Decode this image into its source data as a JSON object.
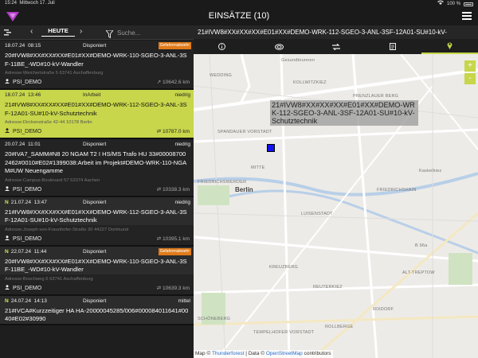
{
  "status": {
    "time": "15:24",
    "date": "Mittwoch 17. Juli",
    "battery": "100 %"
  },
  "header": {
    "title": "EINSÄTZE (10)"
  },
  "list_toolbar": {
    "today_label": "HEUTE",
    "search_placeholder": "Suche..."
  },
  "detail": {
    "title": "21#IVW8#XX#XX#XX#E01#XX#DEMO-WRK-112-SGEO-3-ANL-3SF-12A01-SU#10-kV-"
  },
  "cards": [
    {
      "date": "18.07.24",
      "time": "08:15",
      "status": "Disponiert",
      "badge": "Gefahrenabwehr",
      "priority": "",
      "n": "",
      "text": "20#IVW8#XX#XX#XX#E01#XX#DEMO-WRK-110-SGEO-3-ANL-3SF-11BE_-WD#10-kV-Wandler",
      "address": "Adresse:Weichertstraße 5 63741 Aschaffenburg",
      "user": "PSI_DEMO",
      "distance": "10642.6 km"
    },
    {
      "date": "18.07.24",
      "time": "13:46",
      "status": "InArbeit",
      "badge": "",
      "priority": "niedrig",
      "n": "",
      "text": "21#IVW8#XX#XX#XX#E01#XX#DEMO-WRK-112-SGEO-3-ANL-3SF-12A01-SU#10-kV-Schutztechnik",
      "address": "Adresse:Dirckenstraße 42-44 10178 Berlin",
      "user": "PSI_DEMO",
      "distance": "10787.0 km"
    },
    {
      "date": "20.07.24",
      "time": "11:01",
      "status": "Disponiert",
      "badge": "",
      "priority": "niedrig",
      "n": "",
      "text": "20#IVA7_SAMM#N8 20 NGAM T2 I HS/MS Trafo HU 33#000087002462#0010#E02#1399038:Arbeit im Projekt#DEMO-WRK-110-NGAM#UW Neuengamme",
      "address": "Adresse:Campus-Boulevard 57 52074 Aachen",
      "user": "PSI_DEMO",
      "distance": "10338.3 km"
    },
    {
      "date": "21.07.24",
      "time": "13:47",
      "status": "Disponiert",
      "badge": "",
      "priority": "niedrig",
      "n": "N",
      "text": "21#IVW8#XX#XX#XX#E01#XX#DEMO-WRK-112-SGEO-3-ANL-3SF-12A01-SU#10-kV-Schutztechnik",
      "address": "Adresse:Joseph-von-Fraunhofer-Straße 20 44227 Dortmund",
      "user": "PSI_DEMO",
      "distance": "10395.1 km"
    },
    {
      "date": "22.07.24",
      "time": "11:44",
      "status": "Disponiert",
      "badge": "Gefahrenabwehr",
      "priority": "",
      "n": "N",
      "text": "20#IVW8#XX#XX#XX#E01#XX#DEMO-WRK-110-SGEO-3-ANL-3SF-11BE_-WD#10-kV-Wandler",
      "address": "Adresse:Boschweg 6 63741 Aschaffenburg",
      "user": "PSI_DEMO",
      "distance": "10639.3 km"
    },
    {
      "date": "24.07.24",
      "time": "14:13",
      "status": "Disponiert",
      "badge": "",
      "priority": "mittel",
      "n": "N",
      "text": "21#IVCA#Kurzzeitiger HA HA-20000045285/006#000084011641#0040#E02#30990",
      "address": "",
      "user": "",
      "distance": ""
    }
  ],
  "map": {
    "tooltip": "21#IVW8#XX#XX#XX#E01#XX#DEMO-WRK-112-SGEO-3-ANL-3SF-12A01-SU#10-kV-Schutztechnik",
    "city": "Berlin",
    "labels": [
      "WEDDING",
      "KOLLWITZKIEZ",
      "PRENZLAUER BERG",
      "SPANDAUER VORSTADT",
      "MITTE",
      "FRIEDRICHSWERDER",
      "FRIEDRICHSHAIN",
      "LUISENSTADT",
      "KREUZBERG",
      "SCHÖNEBERG",
      "TEMPELHOFER VORSTADT",
      "REUTERKIEZ",
      "RIXDORF",
      "ROLLBERGE",
      "Kaskelkiez",
      "ALT-TREPTOW",
      "B 96a",
      "Gesundbrunnen"
    ],
    "attribution": {
      "prefix": "Map ©",
      "tf": "Thunderforest",
      "mid": "| Data ©",
      "osm": "OpenStreetMap",
      "suffix": "contributors"
    },
    "zoom_in": "+",
    "zoom_out": "-"
  }
}
